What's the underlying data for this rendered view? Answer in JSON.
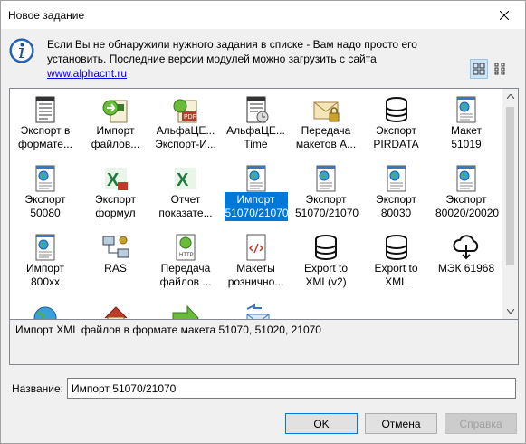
{
  "window": {
    "title": "Новое задание"
  },
  "info": {
    "text": "Если Вы не обнаружили нужного задания в списке - Вам надо просто его установить. Последние версии модулей можно загрузить с сайта",
    "link": "www.alphacnt.ru"
  },
  "items": [
    {
      "l1": "Экспорт в",
      "l2": "формате...",
      "icon": "document-lines-icon"
    },
    {
      "l1": "Импорт",
      "l2": "файлов...",
      "icon": "import-files-icon"
    },
    {
      "l1": "АльфаЦЕ...",
      "l2": "Экспорт-И...",
      "icon": "alphace-export-icon"
    },
    {
      "l1": "АльфаЦЕ...",
      "l2": "Time",
      "icon": "alphace-time-icon"
    },
    {
      "l1": "Передача",
      "l2": "макетов А...",
      "icon": "envelope-lock-icon"
    },
    {
      "l1": "Экспорт",
      "l2": "PIRDATA",
      "icon": "database-icon"
    },
    {
      "l1": "Макет 51019",
      "l2": "",
      "icon": "globe-document-icon"
    },
    {
      "l1": "Экспорт",
      "l2": "50080",
      "icon": "globe-document-icon"
    },
    {
      "l1": "Экспорт",
      "l2": "формул",
      "icon": "excel-export-icon"
    },
    {
      "l1": "Отчет",
      "l2": "показате...",
      "icon": "excel-icon"
    },
    {
      "l1": "Импорт",
      "l2": "51070/21070",
      "icon": "globe-document-icon",
      "selected": true
    },
    {
      "l1": "Экспорт",
      "l2": "51070/21070",
      "icon": "globe-document-icon"
    },
    {
      "l1": "Экспорт",
      "l2": "80030",
      "icon": "globe-document-icon"
    },
    {
      "l1": "Экспорт",
      "l2": "80020/20020",
      "icon": "globe-document-icon"
    },
    {
      "l1": "Импорт",
      "l2": "800xx",
      "icon": "globe-document-icon"
    },
    {
      "l1": "RAS",
      "l2": "",
      "icon": "network-computers-icon"
    },
    {
      "l1": "Передача",
      "l2": "файлов ...",
      "icon": "http-document-icon"
    },
    {
      "l1": "Макеты",
      "l2": "рознично...",
      "icon": "code-document-icon"
    },
    {
      "l1": "Export to",
      "l2": "XML(v2)",
      "icon": "database-icon"
    },
    {
      "l1": "Export to",
      "l2": "XML",
      "icon": "database-icon"
    },
    {
      "l1": "МЭК 61968",
      "l2": "",
      "icon": "cloud-download-icon"
    },
    {
      "l1": "",
      "l2": "",
      "icon": "globe-icon"
    },
    {
      "l1": "",
      "l2": "",
      "icon": "house-icon"
    },
    {
      "l1": "",
      "l2": "",
      "icon": "arrow-right-icon"
    },
    {
      "l1": "",
      "l2": "",
      "icon": "envelope-arrows-icon"
    }
  ],
  "description": "Импорт XML файлов в формате макета 51070, 51020, 21070",
  "name_field": {
    "label": "Название:",
    "value": "Импорт 51070/21070"
  },
  "buttons": {
    "ok": "OK",
    "cancel": "Отмена",
    "apply": "Справка"
  }
}
